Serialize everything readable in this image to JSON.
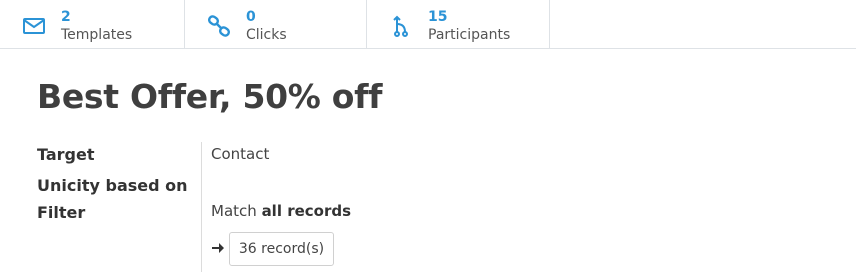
{
  "stats": [
    {
      "value": "2",
      "label": "Templates",
      "icon": "envelope-icon"
    },
    {
      "value": "0",
      "label": "Clicks",
      "icon": "link-icon"
    },
    {
      "value": "15",
      "label": "Participants",
      "icon": "branch-icon"
    }
  ],
  "title": "Best Offer, 50% off",
  "fields": {
    "target_label": "Target",
    "target_value": "Contact",
    "unicity_label": "Unicity based on",
    "filter_label": "Filter",
    "filter_prefix": "Match",
    "filter_value": "all records"
  },
  "records_button": "36 record(s)",
  "colors": {
    "accent": "#2b93d6"
  }
}
